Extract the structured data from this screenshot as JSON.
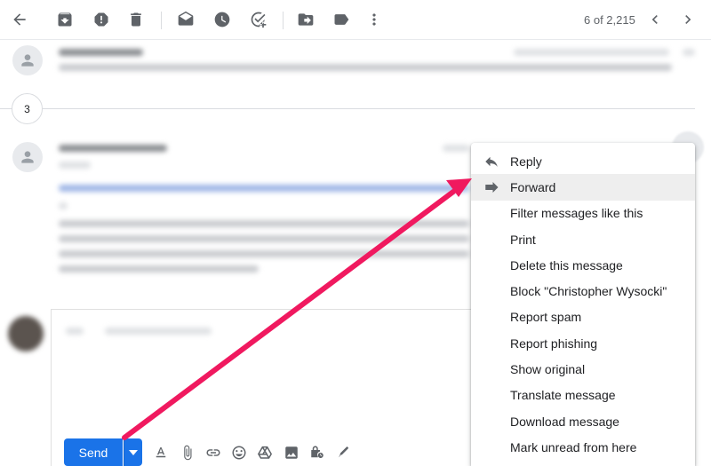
{
  "toolbar": {
    "counter": "6 of 2,215",
    "icons": [
      "back-arrow-icon",
      "archive-icon",
      "report-spam-icon",
      "delete-icon",
      "mark-unread-icon",
      "snooze-icon",
      "add-task-icon",
      "move-to-icon",
      "label-icon",
      "more-vert-icon",
      "chevron-left-icon",
      "chevron-right-icon"
    ]
  },
  "thread": {
    "collapsed_count": "3"
  },
  "compose": {
    "send_label": "Send"
  },
  "menu": {
    "items": [
      {
        "label": "Reply",
        "icon": "reply-icon"
      },
      {
        "label": "Forward",
        "icon": "forward-icon"
      },
      {
        "label": "Filter messages like this"
      },
      {
        "label": "Print"
      },
      {
        "label": "Delete this message"
      },
      {
        "label": "Block \"Christopher Wysocki\""
      },
      {
        "label": "Report spam"
      },
      {
        "label": "Report phishing"
      },
      {
        "label": "Show original"
      },
      {
        "label": "Translate message"
      },
      {
        "label": "Download message"
      },
      {
        "label": "Mark unread from here"
      }
    ]
  },
  "colors": {
    "send_blue": "#1a73e8",
    "annotation_arrow": "#f0195f",
    "hover_gray": "#eeeeee",
    "icon_gray": "#5f6368"
  }
}
